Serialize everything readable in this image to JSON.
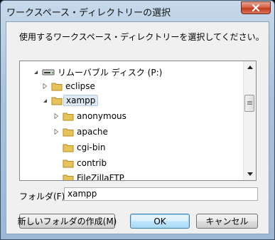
{
  "window": {
    "title": "ワークスペース・ディレクトリーの選択"
  },
  "dialog": {
    "instruction": "使用するワークスペース・ディレクトリーを選択してください。",
    "tree": [
      {
        "label": "リムーバブル ディスク (P:)",
        "icon": "removable-drive-icon",
        "expander": "expanded"
      },
      {
        "label": "eclipse",
        "icon": "folder-icon",
        "expander": "collapsed"
      },
      {
        "label": "xampp",
        "icon": "folder-icon",
        "expander": "expanded",
        "selected": true
      },
      {
        "label": "anonymous",
        "icon": "folder-icon",
        "expander": "collapsed"
      },
      {
        "label": "apache",
        "icon": "folder-icon",
        "expander": "collapsed"
      },
      {
        "label": "cgi-bin",
        "icon": "folder-icon",
        "expander": "none"
      },
      {
        "label": "contrib",
        "icon": "folder-icon",
        "expander": "none"
      },
      {
        "label": "FileZillaFTP",
        "icon": "folder-icon",
        "expander": "none"
      }
    ],
    "folder_label": "フォルダ(F):",
    "folder_value": "xampp",
    "buttons": {
      "new_folder": "新しいフォルダの作成(M)",
      "ok": "OK",
      "cancel": "キャンセル"
    }
  },
  "colors": {
    "folder": "#e8c25a",
    "selection": "#dfe9f5",
    "close": "#c23a1f"
  }
}
